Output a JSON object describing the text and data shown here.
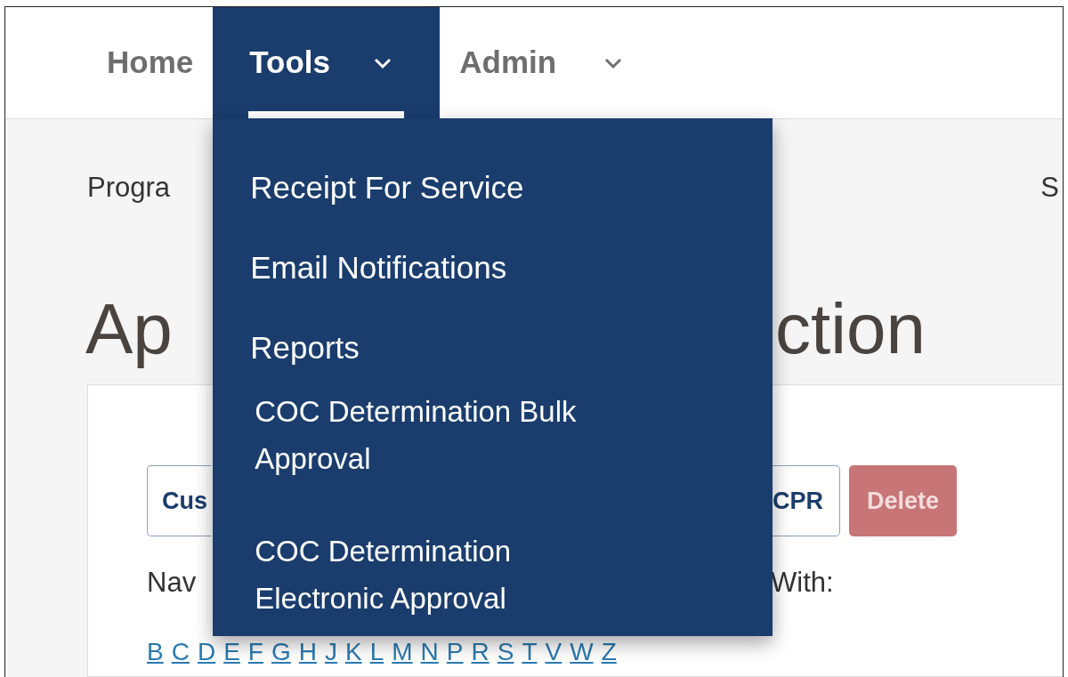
{
  "nav": [
    {
      "label": "Home",
      "selected": false,
      "dropdown": false
    },
    {
      "label": "Tools",
      "selected": true,
      "dropdown": true
    },
    {
      "label": "Admin",
      "selected": false,
      "dropdown": true
    }
  ],
  "tools_menu": [
    {
      "kind": "item",
      "label": "Receipt For Service"
    },
    {
      "kind": "item",
      "label": "Email Notifications"
    },
    {
      "kind": "item",
      "label": "Reports"
    },
    {
      "kind": "subitem",
      "label": "COC Determination Bulk Approval"
    },
    {
      "kind": "subitem",
      "label": "COC Determination Electronic Approval"
    }
  ],
  "breadcrumb_left": "Progra",
  "top_right_text": "S",
  "page_title": {
    "left": "Ap",
    "right": "ction"
  },
  "card": {
    "buttons": [
      {
        "label": "Cus",
        "kind": "outline"
      },
      {
        "label": "CPR",
        "kind": "outline"
      },
      {
        "label": "Delete",
        "kind": "danger",
        "disabled": true
      }
    ],
    "nav_text": {
      "left": "Nav",
      "right": "With:"
    },
    "letters": [
      "B",
      "C",
      "D",
      "E",
      "F",
      "G",
      "H",
      "J",
      "K",
      "L",
      "M",
      "N",
      "P",
      "R",
      "S",
      "T",
      "V",
      "W",
      "Z"
    ]
  }
}
